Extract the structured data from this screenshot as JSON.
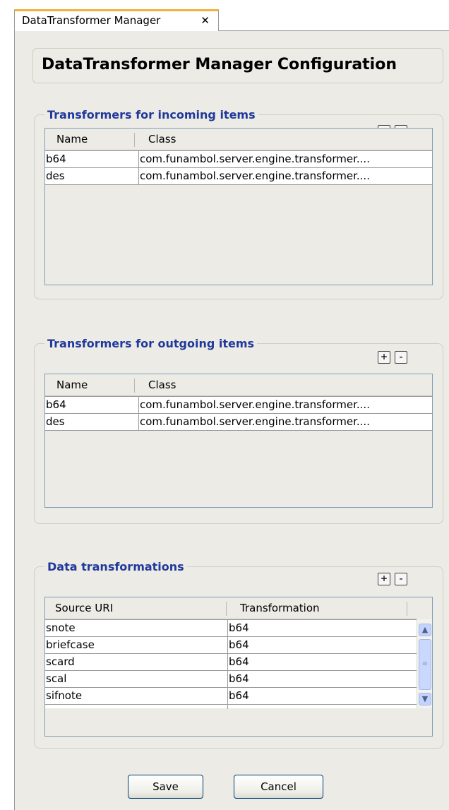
{
  "tab": {
    "title": "DataTransformer Manager",
    "close_glyph": "✕"
  },
  "header": {
    "title": "DataTransformer Manager Configuration"
  },
  "incoming": {
    "title": "Transformers for incoming items",
    "columns": [
      "Name",
      "Class"
    ],
    "rows": [
      [
        "b64",
        "com.funambol.server.engine.transformer...."
      ],
      [
        "des",
        "com.funambol.server.engine.transformer...."
      ]
    ]
  },
  "outgoing": {
    "title": "Transformers for outgoing items",
    "columns": [
      "Name",
      "Class"
    ],
    "rows": [
      [
        "b64",
        "com.funambol.server.engine.transformer...."
      ],
      [
        "des",
        "com.funambol.server.engine.transformer...."
      ]
    ]
  },
  "transformations": {
    "title": "Data transformations",
    "columns": [
      "Source URI",
      "Transformation"
    ],
    "rows": [
      [
        "snote",
        "b64"
      ],
      [
        "briefcase",
        "b64"
      ],
      [
        "scard",
        "b64"
      ],
      [
        "scal",
        "b64"
      ],
      [
        "sifnote",
        "b64"
      ]
    ]
  },
  "icons": {
    "add": "plus-icon",
    "remove": "minus-icon"
  },
  "buttons": {
    "save": "Save",
    "cancel": "Cancel"
  },
  "colors": {
    "group_title": "#21399c",
    "panel": "#ecebe5",
    "tab_accent": "#f2b33d"
  }
}
